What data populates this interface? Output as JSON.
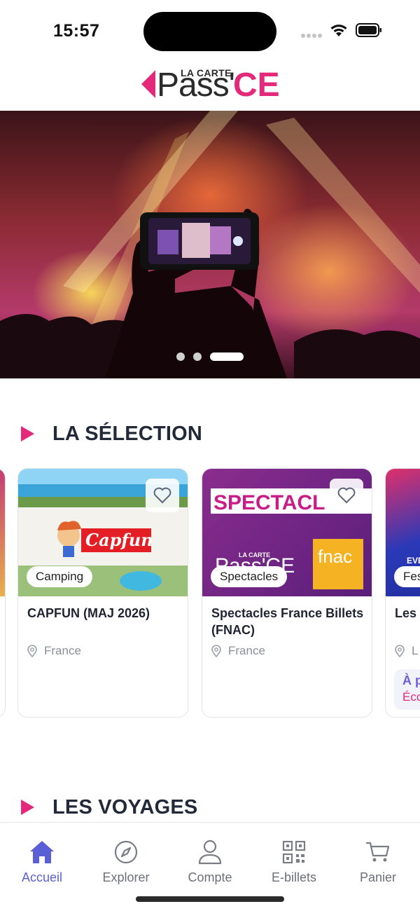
{
  "status_bar": {
    "time": "15:57"
  },
  "logo": {
    "small_text": "LA CARTE",
    "main_text": "Pass'",
    "accent_text": "CE"
  },
  "hero": {
    "slides": 3,
    "active_slide": 3
  },
  "sections": {
    "selection_title": "LA SÉLECTION",
    "voyages_title": "LES VOYAGES"
  },
  "cards": [
    {
      "tag": "Camping",
      "title": "CAPFUN (MAJ 2026)",
      "location": "France",
      "image_text": "Capfun"
    },
    {
      "tag": "Spectacles",
      "title": "Spectacles France Billets (FNAC)",
      "location": "France",
      "image_text": "SPECTACL",
      "image_logo_small": "LA CARTE",
      "image_logo": "Pass'CE",
      "image_brand": "fnac"
    },
    {
      "tag": "Fes",
      "title": "Les",
      "location": "L",
      "promo_line1": "À p",
      "promo_line2": "Éco",
      "image_text": "EVE"
    }
  ],
  "colors": {
    "accent": "#e4297a",
    "active_tab": "#5b5fd6",
    "text_dark": "#1f2433",
    "muted": "#8a8f98"
  },
  "tabbar": {
    "tabs": [
      {
        "label": "Accueil",
        "icon": "home-icon",
        "active": true
      },
      {
        "label": "Explorer",
        "icon": "compass-icon"
      },
      {
        "label": "Compte",
        "icon": "user-icon"
      },
      {
        "label": "E-billets",
        "icon": "qr-code-icon"
      },
      {
        "label": "Panier",
        "icon": "cart-icon"
      }
    ]
  }
}
